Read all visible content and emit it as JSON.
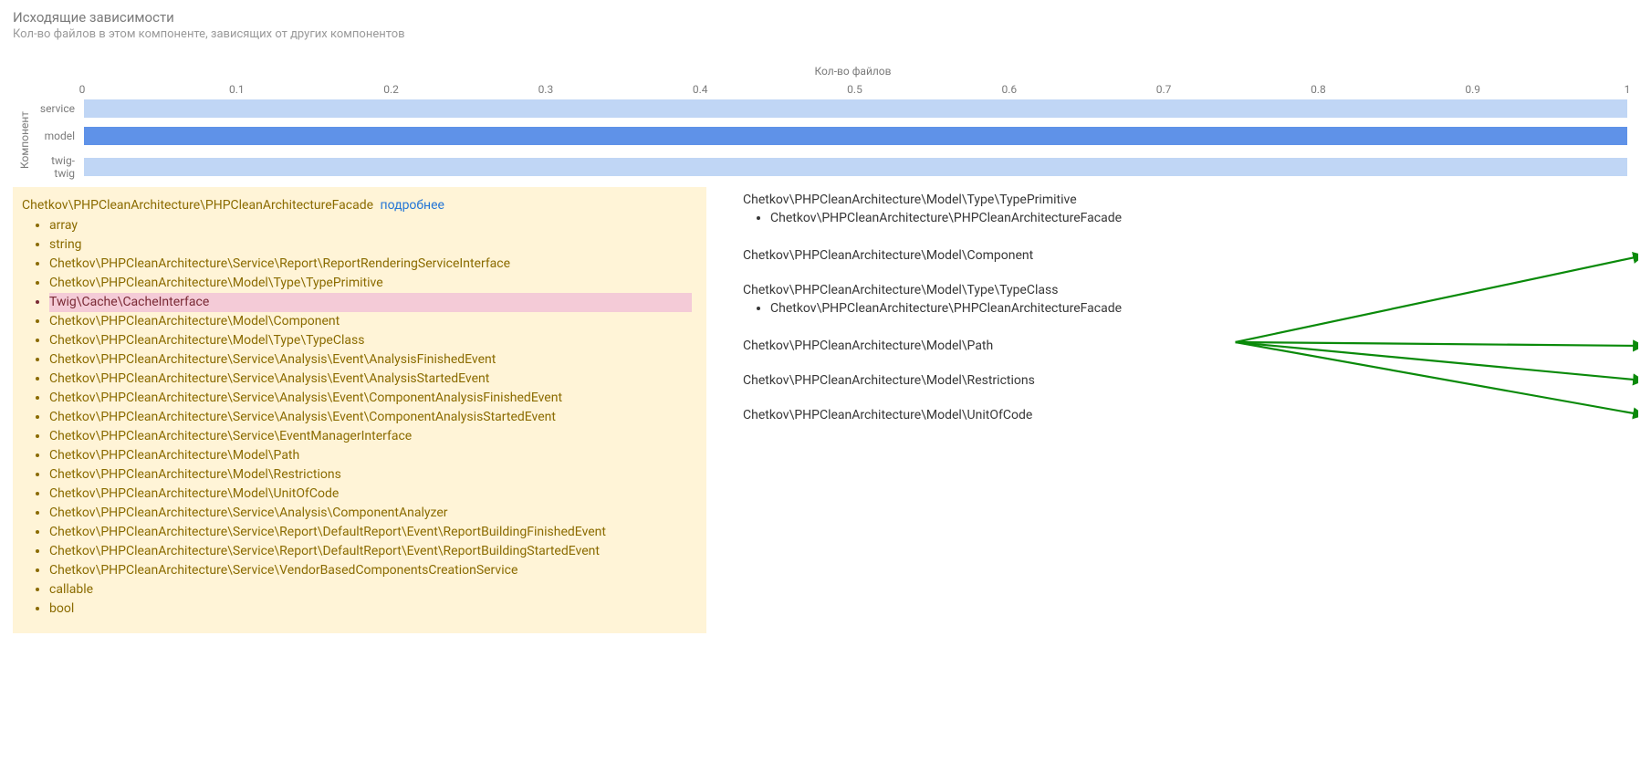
{
  "header": {
    "title": "Исходящие зависимости",
    "subtitle": "Кол-во файлов в этом компоненте, зависящих от других компонентов"
  },
  "chart_data": {
    "type": "bar",
    "orientation": "horizontal",
    "xlabel": "Кол-во файлов",
    "ylabel": "Компонент",
    "xlim": [
      0,
      1
    ],
    "xticks": [
      0,
      0.1,
      0.2,
      0.3,
      0.4,
      0.5,
      0.6,
      0.7,
      0.8,
      0.9,
      1
    ],
    "series": [
      {
        "name": "service",
        "value": 1.0,
        "color": "#c0d6f5"
      },
      {
        "name": "model",
        "value": 1.0,
        "color": "#5f92e8"
      },
      {
        "name": "twig-twig",
        "value": 1.0,
        "color": "#c0d6f5"
      }
    ]
  },
  "left_panel": {
    "heading": "Chetkov\\PHPCleanArchitecture\\PHPCleanArchitectureFacade",
    "more_label": "подробнее",
    "items": [
      {
        "text": "array"
      },
      {
        "text": "string"
      },
      {
        "text": "Chetkov\\PHPCleanArchitecture\\Service\\Report\\ReportRenderingServiceInterface"
      },
      {
        "text": "Chetkov\\PHPCleanArchitecture\\Model\\Type\\TypePrimitive"
      },
      {
        "text": "Twig\\Cache\\CacheInterface",
        "highlight": true
      },
      {
        "text": "Chetkov\\PHPCleanArchitecture\\Model\\Component"
      },
      {
        "text": "Chetkov\\PHPCleanArchitecture\\Model\\Type\\TypeClass"
      },
      {
        "text": "Chetkov\\PHPCleanArchitecture\\Service\\Analysis\\Event\\AnalysisFinishedEvent"
      },
      {
        "text": "Chetkov\\PHPCleanArchitecture\\Service\\Analysis\\Event\\AnalysisStartedEvent"
      },
      {
        "text": "Chetkov\\PHPCleanArchitecture\\Service\\Analysis\\Event\\ComponentAnalysisFinishedEvent"
      },
      {
        "text": "Chetkov\\PHPCleanArchitecture\\Service\\Analysis\\Event\\ComponentAnalysisStartedEvent"
      },
      {
        "text": "Chetkov\\PHPCleanArchitecture\\Service\\EventManagerInterface"
      },
      {
        "text": "Chetkov\\PHPCleanArchitecture\\Model\\Path"
      },
      {
        "text": "Chetkov\\PHPCleanArchitecture\\Model\\Restrictions"
      },
      {
        "text": "Chetkov\\PHPCleanArchitecture\\Model\\UnitOfCode"
      },
      {
        "text": "Chetkov\\PHPCleanArchitecture\\Service\\Analysis\\ComponentAnalyzer"
      },
      {
        "text": "Chetkov\\PHPCleanArchitecture\\Service\\Report\\DefaultReport\\Event\\ReportBuildingFinishedEvent"
      },
      {
        "text": "Chetkov\\PHPCleanArchitecture\\Service\\Report\\DefaultReport\\Event\\ReportBuildingStartedEvent"
      },
      {
        "text": "Chetkov\\PHPCleanArchitecture\\Service\\VendorBasedComponentsCreationService"
      },
      {
        "text": "callable"
      },
      {
        "text": "bool"
      }
    ]
  },
  "right_panel": {
    "blocks": [
      {
        "title": "Chetkov\\PHPCleanArchitecture\\Model\\Type\\TypePrimitive",
        "sub": [
          "Chetkov\\PHPCleanArchitecture\\PHPCleanArchitectureFacade"
        ]
      },
      {
        "title": "Chetkov\\PHPCleanArchitecture\\Model\\Component",
        "sub": []
      },
      {
        "title": "Chetkov\\PHPCleanArchitecture\\Model\\Type\\TypeClass",
        "sub": [
          "Chetkov\\PHPCleanArchitecture\\PHPCleanArchitectureFacade"
        ]
      },
      {
        "title": "Chetkov\\PHPCleanArchitecture\\Model\\Path",
        "sub": []
      },
      {
        "title": "Chetkov\\PHPCleanArchitecture\\Model\\Restrictions",
        "sub": []
      },
      {
        "title": "Chetkov\\PHPCleanArchitecture\\Model\\UnitOfCode",
        "sub": []
      }
    ]
  }
}
